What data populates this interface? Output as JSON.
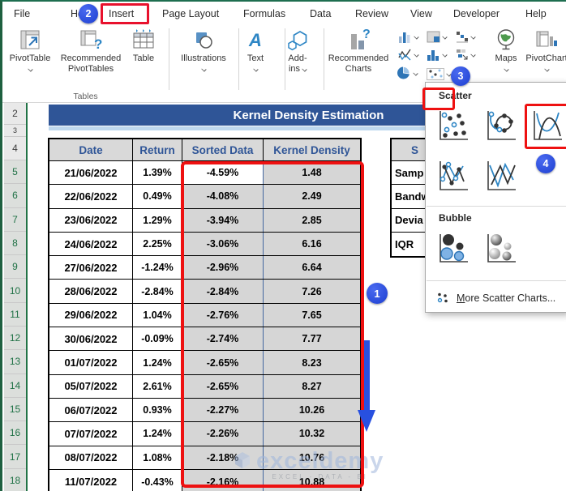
{
  "menu": {
    "file": "File",
    "home": "Home",
    "insert": "Insert",
    "page_layout": "Page Layout",
    "formulas": "Formulas",
    "data": "Data",
    "review": "Review",
    "view": "View",
    "developer": "Developer",
    "help": "Help"
  },
  "ribbon": {
    "pivottable": "PivotTable",
    "recommended_pivottables_line1": "Recommended",
    "recommended_pivottables_line2": "PivotTables",
    "table": "Table",
    "tables_group_label": "Tables",
    "illustrations": "Illustrations",
    "text": "Text",
    "addins_line1": "Add-",
    "addins_line2": "ins",
    "recommended_charts_line1": "Recommended",
    "recommended_charts_line2": "Charts",
    "maps": "Maps",
    "pivotchart": "PivotChart"
  },
  "dropdown": {
    "scatter_header": "Scatter",
    "bubble_header": "Bubble",
    "more_label": "More Scatter Charts..."
  },
  "annotations": {
    "badge1": "1",
    "badge2": "2",
    "badge3": "3",
    "badge4": "4"
  },
  "sheet": {
    "title": "Kernel Density Estimation",
    "row_headers_top": [
      "2",
      "3",
      "4"
    ],
    "row_headers_selected": [
      "5",
      "6",
      "7",
      "8",
      "9",
      "10",
      "11",
      "12",
      "13",
      "14",
      "15",
      "16",
      "17",
      "18"
    ],
    "table": {
      "headers": [
        "Date",
        "Return",
        "Sorted Data",
        "Kernel Density"
      ],
      "rows": [
        [
          "21/06/2022",
          "1.39%",
          "-4.59%",
          "1.48"
        ],
        [
          "22/06/2022",
          "0.49%",
          "-4.08%",
          "2.49"
        ],
        [
          "23/06/2022",
          "1.29%",
          "-3.94%",
          "2.85"
        ],
        [
          "24/06/2022",
          "2.25%",
          "-3.06%",
          "6.16"
        ],
        [
          "27/06/2022",
          "-1.24%",
          "-2.96%",
          "6.64"
        ],
        [
          "28/06/2022",
          "-2.84%",
          "-2.84%",
          "7.26"
        ],
        [
          "29/06/2022",
          "1.04%",
          "-2.76%",
          "7.65"
        ],
        [
          "30/06/2022",
          "-0.09%",
          "-2.74%",
          "7.77"
        ],
        [
          "01/07/2022",
          "1.24%",
          "-2.65%",
          "8.23"
        ],
        [
          "05/07/2022",
          "2.61%",
          "-2.65%",
          "8.27"
        ],
        [
          "06/07/2022",
          "0.93%",
          "-2.27%",
          "10.26"
        ],
        [
          "07/07/2022",
          "1.24%",
          "-2.26%",
          "10.32"
        ],
        [
          "08/07/2022",
          "1.08%",
          "-2.18%",
          "10.76"
        ],
        [
          "11/07/2022",
          "-0.43%",
          "-2.16%",
          "10.88"
        ]
      ]
    },
    "side_table": {
      "header_clipped": "S",
      "rows_clipped": [
        "Samp",
        "Bandw",
        "Devia",
        "IQR"
      ]
    },
    "watermark": {
      "name": "exceldemy",
      "tagline": "EXCEL - DATA - BI"
    }
  },
  "colors": {
    "annotation_red": "#ee1111",
    "badge_blue": "#2746d6",
    "title_navy": "#2f5597",
    "title_strip_blue": "#bdd7ee",
    "header_gray": "#d9d9d9",
    "selection_gray": "#d6d6d6",
    "excel_green": "#217346",
    "arrow_blue": "#2850e0"
  }
}
